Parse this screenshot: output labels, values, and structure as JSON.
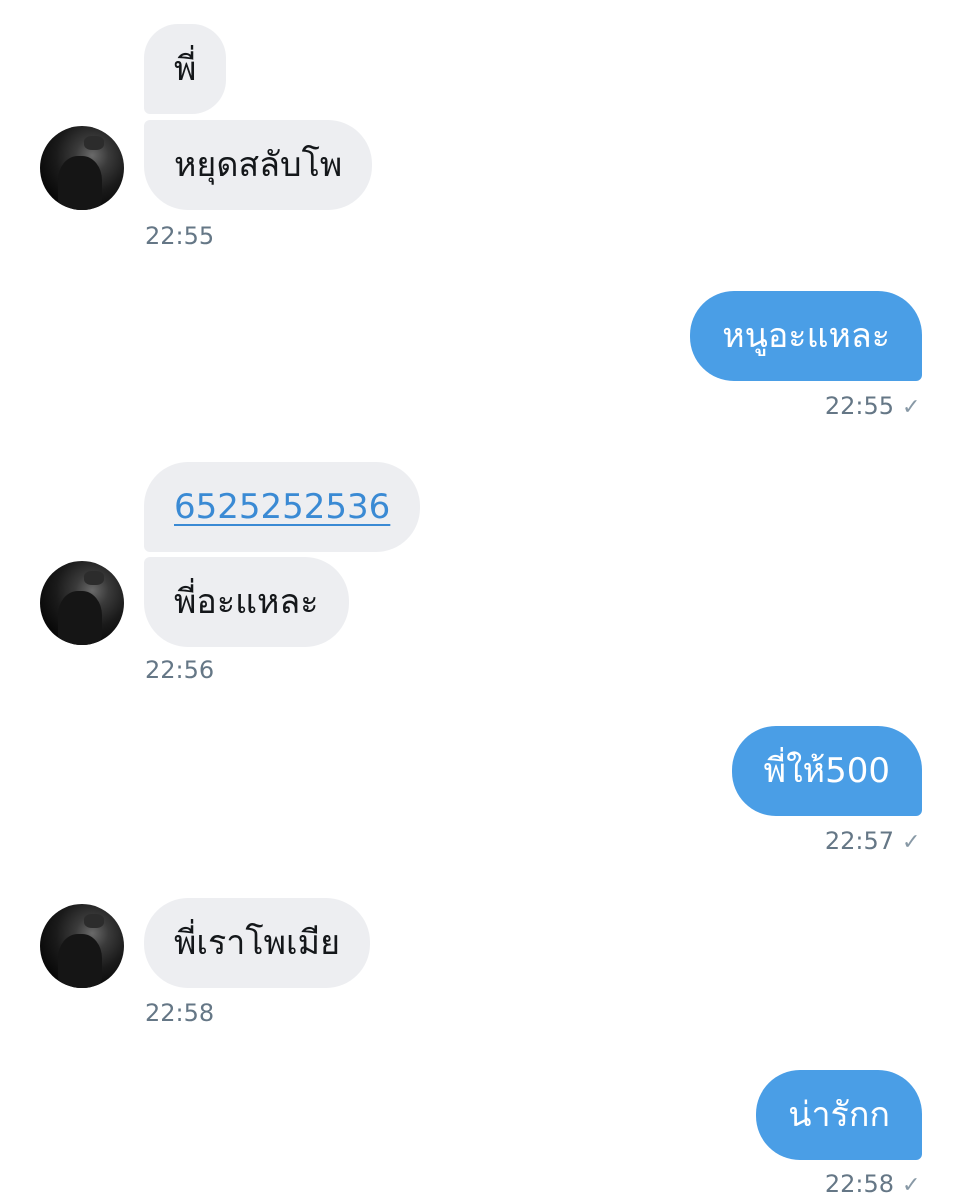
{
  "messages": {
    "m1": {
      "text": "พี่"
    },
    "m2": {
      "text": "หยุดสลับโพ",
      "time": "22:55"
    },
    "m3": {
      "text": "หนูอะแหละ",
      "time": "22:55"
    },
    "m4": {
      "text": "6525252536"
    },
    "m5": {
      "text": "พี่อะแหละ",
      "time": "22:56"
    },
    "m6": {
      "text": "พี่ให้500",
      "time": "22:57"
    },
    "m7": {
      "text": "พี่เราโพเมีย",
      "time": "22:58"
    },
    "m8": {
      "text": "น่ารักก",
      "time": "22:58"
    }
  },
  "icons": {
    "sent_check": "✓"
  },
  "colors": {
    "incoming_bubble": "#edeef1",
    "outgoing_bubble": "#4a9ee6",
    "timestamp": "#657786",
    "link": "#3a8ad4"
  }
}
